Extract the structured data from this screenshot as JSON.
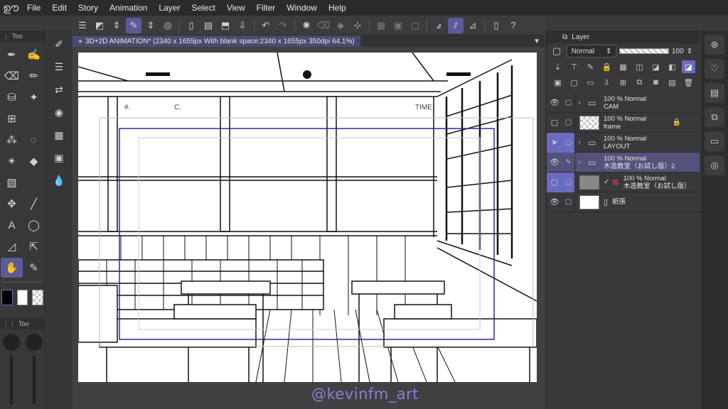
{
  "menu": [
    "File",
    "Edit",
    "Story",
    "Animation",
    "Layer",
    "Select",
    "View",
    "Filter",
    "Window",
    "Help"
  ],
  "tab": {
    "title": "3D+2D ANIMATION* (2340 x 1655px With blank space:2340 x 1655px 350dpi 64.1%)"
  },
  "left_panel": {
    "label": "Too",
    "sub_label": "Too"
  },
  "tools": [
    {
      "icon": "pen-icon",
      "active": false
    },
    {
      "icon": "marker-icon",
      "active": false
    },
    {
      "icon": "eraser-icon",
      "active": false
    },
    {
      "icon": "pencil-icon",
      "active": false
    },
    {
      "icon": "fill-icon",
      "active": false
    },
    {
      "icon": "sparkle-icon",
      "active": false
    },
    {
      "icon": "frame-icon",
      "active": false
    },
    {
      "icon": "blank-icon",
      "active": false
    },
    {
      "icon": "drops-icon",
      "active": false
    },
    {
      "icon": "lasso-icon",
      "active": false
    },
    {
      "icon": "magic-wand-icon",
      "active": false
    },
    {
      "icon": "bucket-icon",
      "active": false
    },
    {
      "icon": "gradient-icon",
      "active": false
    },
    {
      "icon": "blank-icon",
      "active": false
    },
    {
      "icon": "move-icon",
      "active": false
    },
    {
      "icon": "line-icon",
      "active": false
    },
    {
      "icon": "text-icon",
      "active": false
    },
    {
      "icon": "balloon-icon",
      "active": false
    },
    {
      "icon": "ruler-icon",
      "active": false
    },
    {
      "icon": "object-select-icon",
      "active": false
    },
    {
      "icon": "hand-icon",
      "active": true
    },
    {
      "icon": "eyedropper-icon",
      "active": false
    }
  ],
  "colors": {
    "main": "#000000",
    "sub": "#ffffff",
    "accent": "#5b5b9c",
    "layer_highlight": "#6a6abf",
    "watermark": "#8a7fd6"
  },
  "layer_panel": {
    "title": "Layer",
    "blend_mode": "Normal",
    "opacity": "100",
    "layers": [
      {
        "opacity": "100 % Normal",
        "name": "CAM",
        "type": "folder",
        "eye": true,
        "selected": false,
        "highlight": false
      },
      {
        "opacity": "100 % Normal",
        "name": "frame",
        "type": "raster",
        "eye": false,
        "selected": false,
        "highlight": false,
        "locked": true
      },
      {
        "opacity": "100 % Normal",
        "name": "LAYOUT",
        "type": "folder",
        "eye": false,
        "selected": false,
        "highlight": true
      },
      {
        "opacity": "100 % Normal",
        "name": "木造教室（お試し版）2",
        "type": "folder",
        "eye": true,
        "selected": true,
        "highlight": false
      },
      {
        "opacity": "100 % Normal",
        "name": "木造教室（お試し版）",
        "type": "3d",
        "eye": false,
        "selected": false,
        "highlight": true
      },
      {
        "opacity": "",
        "name": "紙張",
        "type": "paper",
        "eye": true,
        "selected": false,
        "highlight": false
      }
    ]
  },
  "canvas_labels": {
    "hash": "#.",
    "c": "C.",
    "time": "TIME"
  },
  "watermark": "@kevinfm_art"
}
